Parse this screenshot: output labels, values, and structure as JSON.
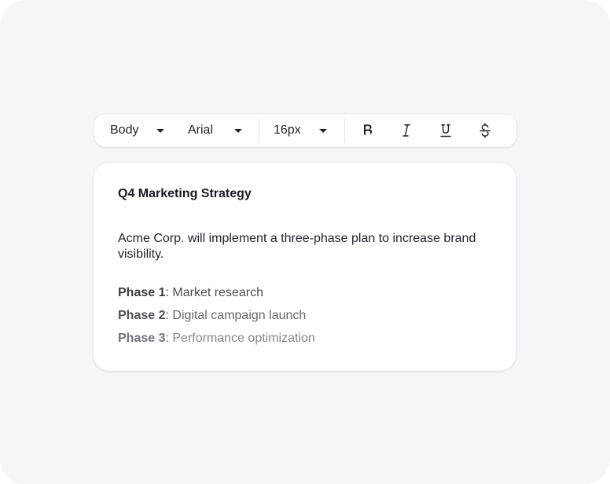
{
  "toolbar": {
    "style_select": {
      "value": "Body",
      "icon": "caret-down-icon"
    },
    "font_select": {
      "value": "Arial",
      "icon": "caret-down-icon"
    },
    "size_select": {
      "value": "16px",
      "icon": "caret-down-icon"
    },
    "format_buttons": [
      {
        "name": "bold",
        "icon": "bold-icon"
      },
      {
        "name": "italic",
        "icon": "italic-icon"
      },
      {
        "name": "underline",
        "icon": "underline-icon"
      },
      {
        "name": "strikethrough",
        "icon": "strikethrough-icon"
      }
    ]
  },
  "document": {
    "title": "Q4 Marketing Strategy",
    "paragraph": "Acme Corp. will implement a three-phase plan to increase brand visibility.",
    "phases": [
      {
        "label": "Phase 1",
        "separator": ":",
        "text": " Market research"
      },
      {
        "label": "Phase 2",
        "separator": ":",
        "text": " Digital campaign launch"
      },
      {
        "label": "Phase 3",
        "separator": ":",
        "text": " Performance optimization"
      }
    ]
  },
  "colors": {
    "background": "#f5f6f8",
    "surface": "#ffffff",
    "text": "#1f2128",
    "separator": "#e4e6ea"
  }
}
